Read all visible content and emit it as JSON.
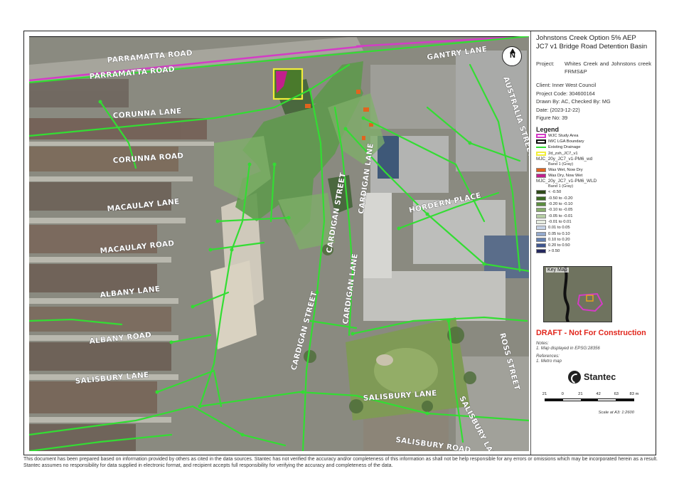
{
  "title_line1": "Johnstons Creek Option 5% AEP",
  "title_line2": "JC7 v1 Bridge Road Detention Basin",
  "project_label": "Project:",
  "project_value": "Whites Creek and Johnstons creek FRMS&P",
  "client": "Client:  Inner West Council",
  "project_code": "Project Code:  304600164",
  "drawn_by": "Drawn By:  AC, Checked By: MG",
  "date": "Date:  (2023-12-22)",
  "figure_no": "Figure No:  39",
  "legend": {
    "title": "Legend",
    "items": [
      {
        "label": "WJC Study Area",
        "color": "#d43cc6",
        "style": "outline"
      },
      {
        "label": "IWC LGA Boundary",
        "color": "#111111",
        "style": "outline"
      },
      {
        "label": "Existing Drainage",
        "color": "#33dd33",
        "style": "line"
      },
      {
        "label": "2d_zsh_JC7_v1",
        "color": "#f2ee3a",
        "style": "outline"
      }
    ],
    "group1_title": "MJC_20y_JC7_v1-PM6_wd",
    "group1_band": "Band 1 (Gray)",
    "group1_items": [
      {
        "label": "Was Wet, Now Dry",
        "color": "#e0641e"
      },
      {
        "label": "Was Dry, Now Wet",
        "color": "#c21f8c"
      }
    ],
    "group2_title": "MJC_20y_JC7_v1-PM6_WLD",
    "group2_band": "Band 1 (Gray)",
    "group2_items": [
      {
        "label": "< -0.50",
        "color": "#2f4a19"
      },
      {
        "label": "-0.50 to -0.20",
        "color": "#3d6b25"
      },
      {
        "label": "-0.20 to -0.10",
        "color": "#5b8d3f"
      },
      {
        "label": "-0.10 to -0.05",
        "color": "#87ad6c"
      },
      {
        "label": "-0.05 to -0.01",
        "color": "#b6cea5"
      },
      {
        "label": "-0.01 to 0.01",
        "color": "#e6ece0"
      },
      {
        "label": "0.01 to 0.05",
        "color": "#c5d2e6"
      },
      {
        "label": "0.05 to 0.10",
        "color": "#93a9cc"
      },
      {
        "label": "0.10 to 0.20",
        "color": "#6480b0"
      },
      {
        "label": "0.20 to 0.50",
        "color": "#3f558f"
      },
      {
        "label": "> 0.50",
        "color": "#24285e"
      }
    ]
  },
  "keymap_label": "Key Map",
  "draft": "DRAFT - Not For Construction",
  "notes_title": "Notes:",
  "notes_1": "1. Map displayed in EPSG:28356",
  "refs_title": "References:",
  "refs_1": "1. Metro map",
  "logo_text": "Stantec",
  "scale_ticks": [
    "21",
    "0",
    "21",
    "42",
    "63",
    "83 m"
  ],
  "scale_ratio": "Scale at A3: 1:2600",
  "north_label": "N",
  "streets": {
    "parramatta_1": "PARRAMATTA ROAD",
    "parramatta_2": "PARRAMATTA ROAD",
    "gantry": "GANTRY LANE",
    "australia": "AUSTRALIA STREET",
    "corunna_lane": "CORUNNA LANE",
    "corunna_road": "CORUNNA ROAD",
    "cardigan_street_1": "CARDIGAN STREET",
    "cardigan_lane_1": "CARDIGAN LANE",
    "macaulay_lane": "MACAULAY LANE",
    "macaulay_road": "MACAULAY ROAD",
    "hordern": "HORDERN PLACE",
    "albany_lane": "ALBANY LANE",
    "albany_road": "ALBANY ROAD",
    "cardigan_street_2": "CARDIGAN STREET",
    "cardigan_lane_2": "CARDIGAN LANE",
    "ross": "ROSS STREET",
    "salisbury_lane_1": "SALISBURY LANE",
    "salisbury_lane_2": "SALISBURY LANE",
    "salisbury_lane_3": "SALISBURY LANE",
    "salisbury_road": "SALISBURY ROAD"
  },
  "disclaimer": "This document has been prepared based on information provided by others as cited in the data sources. Stantec has not verified the accuracy and/or completeness of this information as shall not be help responsible for any errors or omissions which may be incorporated herein as a result. Stantec assumes no responsibility for data supplied in electronic format, and recipient accepts full responsibility for verifying the accuracy and completeness of the data."
}
